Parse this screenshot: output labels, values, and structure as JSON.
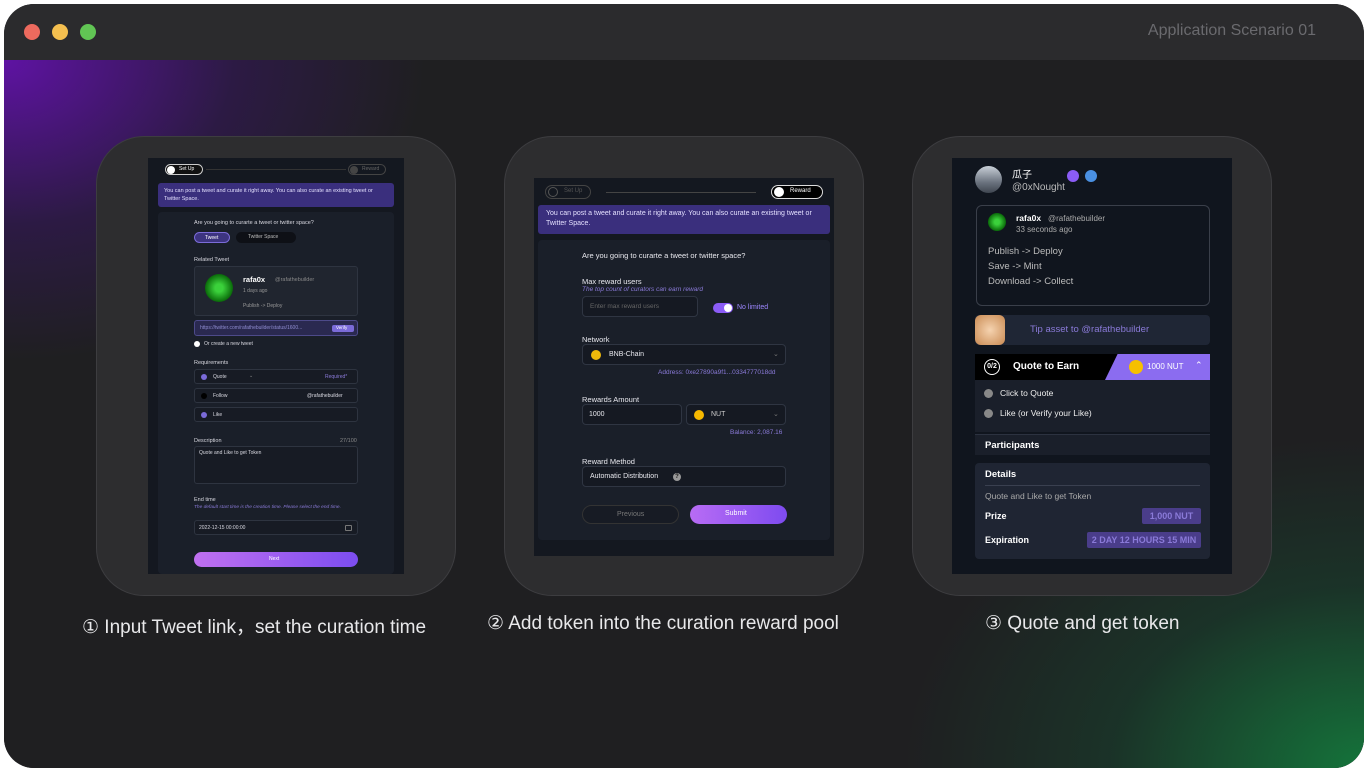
{
  "window": {
    "title": "Application Scenario 01"
  },
  "captions": [
    "① Input Tweet link，set the curation time",
    "② Add token into the curation reward pool",
    "③ Quote and get token"
  ],
  "screen1": {
    "step1": "Set Up",
    "step2": "Reward",
    "banner": "You can post a tweet and curate it right away. You can also curate an existing tweet or Twitter Space.",
    "question": "Are you going to curarte a tweet or twitter space?",
    "tab_tweet": "Tweet",
    "tab_space": "Twitter Space",
    "related_label": "Related Tweet",
    "tweet_user": "rafa0x",
    "tweet_handle": "@rafathebuilder",
    "tweet_time": "1 days ago",
    "tweet_text": "Publish -> Deploy",
    "link_value": "https://twitter.com/rafathebuilder/status/1600...",
    "verify": "Verify",
    "create_new": "Or create a new tweet",
    "requirements_label": "Requirements",
    "req_quote": "Quote",
    "req_required": "Required*",
    "req_follow": "Follow",
    "req_follow_handle": "@rafathebuilder",
    "req_like": "Like",
    "description_label": "Description",
    "description_count": "27/100",
    "description_value": "Quote and Like to get Token",
    "endtime_label": "End time",
    "endtime_hint": "The default start time is the creation time. Please select the end time.",
    "endtime_value": "2022-12-15 00:00:00",
    "next": "Next"
  },
  "screen2": {
    "step1": "Set Up",
    "step2": "Reward",
    "banner": "You can post a tweet and curate it right away. You can also curate an existing tweet or Twitter Space.",
    "question": "Are you going to curarte a tweet or twitter space?",
    "max_label": "Max reward users",
    "max_hint": "The top count of curators can earn reward",
    "max_placeholder": "Enter max reward users",
    "no_limited": "No limited",
    "network_label": "Network",
    "network_value": "BNB-Chain",
    "address": "Address: 0xe27890a9f1...0334777018dd",
    "amount_label": "Rewards Amount",
    "amount_value": "1000",
    "token": "NUT",
    "balance": "Balance: 2,087.16",
    "method_label": "Reward Method",
    "method_value": "Automatic Distribution",
    "previous": "Previous",
    "submit": "Submit"
  },
  "screen3": {
    "user_name": "瓜子",
    "user_handle": "@0xNought",
    "tweet_user": "rafa0x",
    "tweet_handle": "@rafathebuilder",
    "tweet_time": "33 seconds ago",
    "tweet_lines": [
      "Publish -> Deploy",
      "Save -> Mint",
      "Download -> Collect"
    ],
    "tip": "Tip asset to @rafathebuilder",
    "progress": "0/2",
    "quote_title": "Quote to Earn",
    "reward": "1000 NUT",
    "task1": "Click to Quote",
    "task2": "Like (or Verify your Like)",
    "participants": "Participants",
    "details": "Details",
    "details_text": "Quote and Like to get Token",
    "prize_label": "Prize",
    "prize_value": "1,000 NUT",
    "expiration_label": "Expiration",
    "expiration_value": "2 DAY 12 HOURS 15 MIN"
  }
}
